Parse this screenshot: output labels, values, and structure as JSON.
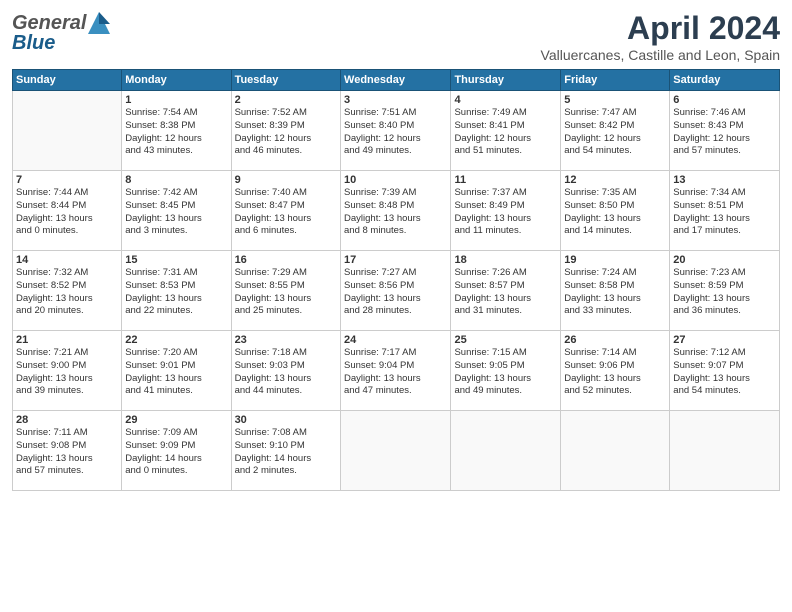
{
  "header": {
    "logo_general": "General",
    "logo_blue": "Blue",
    "title": "April 2024",
    "subtitle": "Valluercanes, Castille and Leon, Spain"
  },
  "days_of_week": [
    "Sunday",
    "Monday",
    "Tuesday",
    "Wednesday",
    "Thursday",
    "Friday",
    "Saturday"
  ],
  "weeks": [
    [
      {
        "day": "",
        "info": ""
      },
      {
        "day": "1",
        "info": "Sunrise: 7:54 AM\nSunset: 8:38 PM\nDaylight: 12 hours\nand 43 minutes."
      },
      {
        "day": "2",
        "info": "Sunrise: 7:52 AM\nSunset: 8:39 PM\nDaylight: 12 hours\nand 46 minutes."
      },
      {
        "day": "3",
        "info": "Sunrise: 7:51 AM\nSunset: 8:40 PM\nDaylight: 12 hours\nand 49 minutes."
      },
      {
        "day": "4",
        "info": "Sunrise: 7:49 AM\nSunset: 8:41 PM\nDaylight: 12 hours\nand 51 minutes."
      },
      {
        "day": "5",
        "info": "Sunrise: 7:47 AM\nSunset: 8:42 PM\nDaylight: 12 hours\nand 54 minutes."
      },
      {
        "day": "6",
        "info": "Sunrise: 7:46 AM\nSunset: 8:43 PM\nDaylight: 12 hours\nand 57 minutes."
      }
    ],
    [
      {
        "day": "7",
        "info": "Sunrise: 7:44 AM\nSunset: 8:44 PM\nDaylight: 13 hours\nand 0 minutes."
      },
      {
        "day": "8",
        "info": "Sunrise: 7:42 AM\nSunset: 8:45 PM\nDaylight: 13 hours\nand 3 minutes."
      },
      {
        "day": "9",
        "info": "Sunrise: 7:40 AM\nSunset: 8:47 PM\nDaylight: 13 hours\nand 6 minutes."
      },
      {
        "day": "10",
        "info": "Sunrise: 7:39 AM\nSunset: 8:48 PM\nDaylight: 13 hours\nand 8 minutes."
      },
      {
        "day": "11",
        "info": "Sunrise: 7:37 AM\nSunset: 8:49 PM\nDaylight: 13 hours\nand 11 minutes."
      },
      {
        "day": "12",
        "info": "Sunrise: 7:35 AM\nSunset: 8:50 PM\nDaylight: 13 hours\nand 14 minutes."
      },
      {
        "day": "13",
        "info": "Sunrise: 7:34 AM\nSunset: 8:51 PM\nDaylight: 13 hours\nand 17 minutes."
      }
    ],
    [
      {
        "day": "14",
        "info": "Sunrise: 7:32 AM\nSunset: 8:52 PM\nDaylight: 13 hours\nand 20 minutes."
      },
      {
        "day": "15",
        "info": "Sunrise: 7:31 AM\nSunset: 8:53 PM\nDaylight: 13 hours\nand 22 minutes."
      },
      {
        "day": "16",
        "info": "Sunrise: 7:29 AM\nSunset: 8:55 PM\nDaylight: 13 hours\nand 25 minutes."
      },
      {
        "day": "17",
        "info": "Sunrise: 7:27 AM\nSunset: 8:56 PM\nDaylight: 13 hours\nand 28 minutes."
      },
      {
        "day": "18",
        "info": "Sunrise: 7:26 AM\nSunset: 8:57 PM\nDaylight: 13 hours\nand 31 minutes."
      },
      {
        "day": "19",
        "info": "Sunrise: 7:24 AM\nSunset: 8:58 PM\nDaylight: 13 hours\nand 33 minutes."
      },
      {
        "day": "20",
        "info": "Sunrise: 7:23 AM\nSunset: 8:59 PM\nDaylight: 13 hours\nand 36 minutes."
      }
    ],
    [
      {
        "day": "21",
        "info": "Sunrise: 7:21 AM\nSunset: 9:00 PM\nDaylight: 13 hours\nand 39 minutes."
      },
      {
        "day": "22",
        "info": "Sunrise: 7:20 AM\nSunset: 9:01 PM\nDaylight: 13 hours\nand 41 minutes."
      },
      {
        "day": "23",
        "info": "Sunrise: 7:18 AM\nSunset: 9:03 PM\nDaylight: 13 hours\nand 44 minutes."
      },
      {
        "day": "24",
        "info": "Sunrise: 7:17 AM\nSunset: 9:04 PM\nDaylight: 13 hours\nand 47 minutes."
      },
      {
        "day": "25",
        "info": "Sunrise: 7:15 AM\nSunset: 9:05 PM\nDaylight: 13 hours\nand 49 minutes."
      },
      {
        "day": "26",
        "info": "Sunrise: 7:14 AM\nSunset: 9:06 PM\nDaylight: 13 hours\nand 52 minutes."
      },
      {
        "day": "27",
        "info": "Sunrise: 7:12 AM\nSunset: 9:07 PM\nDaylight: 13 hours\nand 54 minutes."
      }
    ],
    [
      {
        "day": "28",
        "info": "Sunrise: 7:11 AM\nSunset: 9:08 PM\nDaylight: 13 hours\nand 57 minutes."
      },
      {
        "day": "29",
        "info": "Sunrise: 7:09 AM\nSunset: 9:09 PM\nDaylight: 14 hours\nand 0 minutes."
      },
      {
        "day": "30",
        "info": "Sunrise: 7:08 AM\nSunset: 9:10 PM\nDaylight: 14 hours\nand 2 minutes."
      },
      {
        "day": "",
        "info": ""
      },
      {
        "day": "",
        "info": ""
      },
      {
        "day": "",
        "info": ""
      },
      {
        "day": "",
        "info": ""
      }
    ]
  ]
}
